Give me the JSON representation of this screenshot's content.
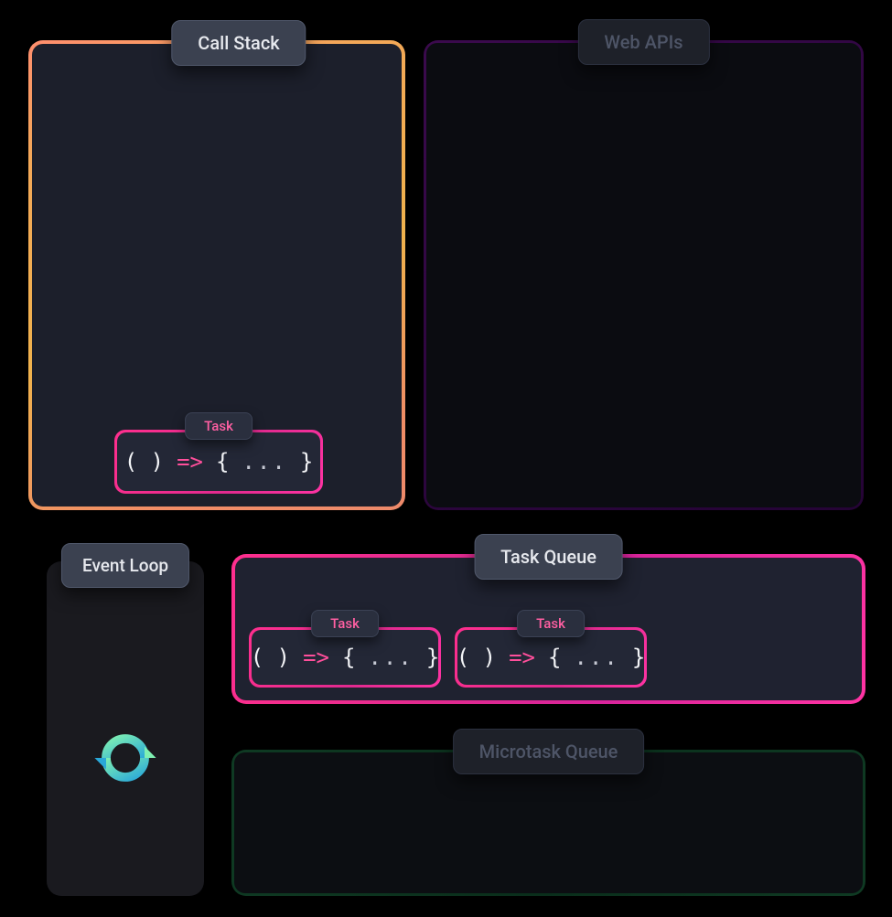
{
  "panels": {
    "call_stack": {
      "title": "Call Stack"
    },
    "web_apis": {
      "title": "Web APIs"
    },
    "event_loop": {
      "title": "Event Loop"
    },
    "task_queue": {
      "title": "Task Queue"
    },
    "microtask_queue": {
      "title": "Microtask Queue"
    }
  },
  "task_badge_label": "Task",
  "code_tokens": {
    "parens": "( )",
    "arrow": "=>",
    "brace_open": "{",
    "ellipsis": "...",
    "brace_close": "}"
  },
  "call_stack_items": [
    {
      "badge": "Task"
    }
  ],
  "task_queue_items": [
    {
      "badge": "Task"
    },
    {
      "badge": "Task"
    }
  ],
  "icons": {
    "event_loop": "refresh-cycle"
  },
  "colors": {
    "call_stack_border": [
      "#ff8e6e",
      "#f0b24d"
    ],
    "web_apis_border": "#3b0a4d",
    "task_queue_border": "#ff2f8e",
    "microtask_queue_border": "#0f3a23",
    "task_arrow": "#ff4f9b",
    "panel_bg": "#1c1f2b"
  }
}
